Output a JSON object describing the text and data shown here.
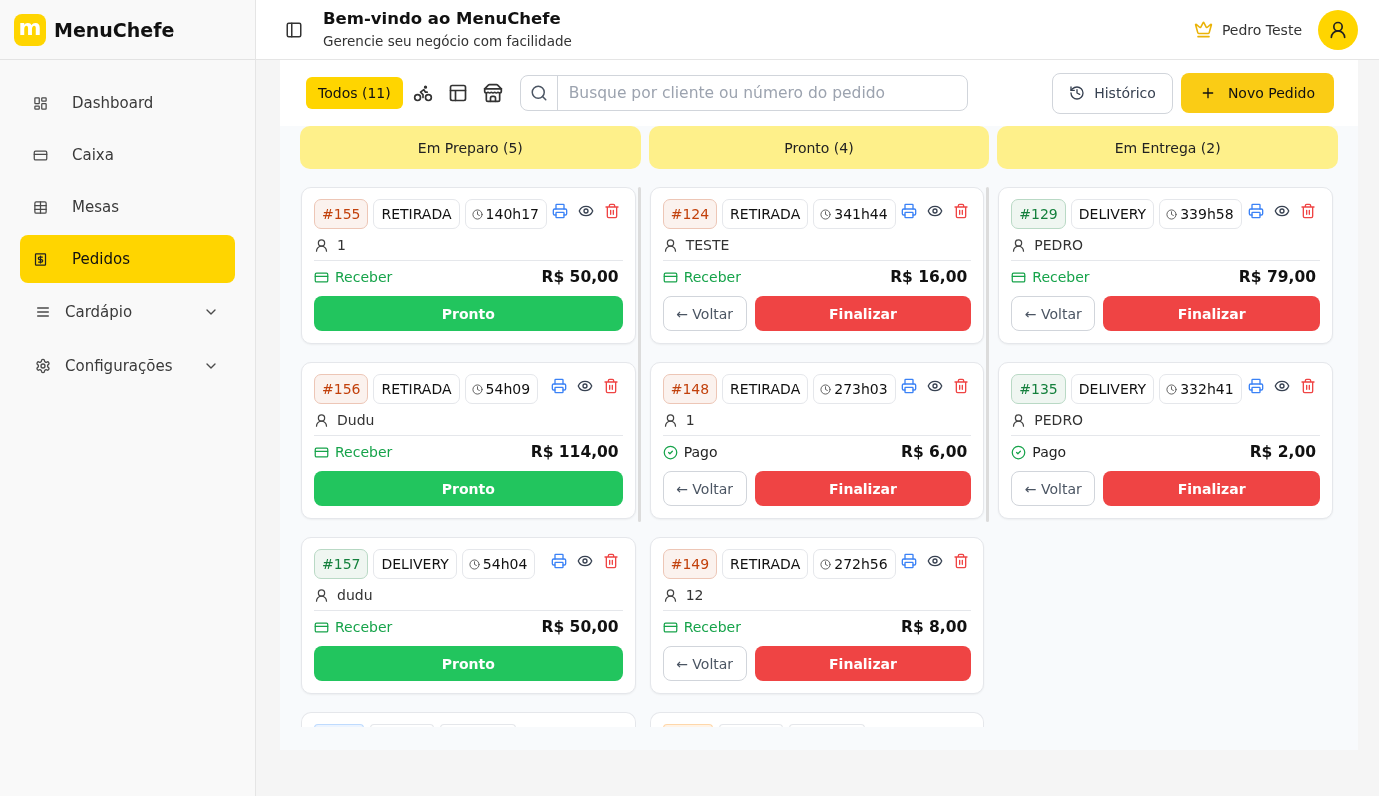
{
  "sidebar": {
    "logo": "m",
    "app_name": "MenuChefe",
    "items": [
      {
        "kind": "link",
        "label": "Dashboard",
        "selected": false
      },
      {
        "kind": "link",
        "label": "Caixa",
        "selected": false
      },
      {
        "kind": "link",
        "label": "Mesas",
        "selected": false
      },
      {
        "kind": "link",
        "label": "Pedidos",
        "selected": true
      },
      {
        "kind": "group",
        "label": "Cardápio",
        "selected": false,
        "expanded": false
      },
      {
        "kind": "group",
        "label": "Configurações",
        "selected": false,
        "expanded": false
      }
    ]
  },
  "header": {
    "title": "Bem-vindo ao MenuChefe",
    "subtitle": "Gerencie seu negócio com facilidade",
    "user": {
      "name": "Pedro Teste"
    }
  },
  "toolbar": {
    "filters": [
      {
        "kind": "text",
        "label": "Todos (11)",
        "selected": true
      },
      {
        "kind": "icon",
        "selected": false
      },
      {
        "kind": "icon",
        "selected": false
      },
      {
        "kind": "icon",
        "selected": false
      }
    ],
    "search": {
      "placeholder": "Busque por cliente ou número do pedido"
    },
    "buttons": [
      {
        "kind": "secondary",
        "label": "Histórico"
      },
      {
        "kind": "primary",
        "label": "Novo Pedido"
      }
    ]
  },
  "columns": [
    {
      "title": "Em Preparo (5)",
      "cards": [
        {
          "kind": "full",
          "order": "#155",
          "color": "#c2410c",
          "type": "RETIRADA",
          "time": "140h17",
          "customer": "1",
          "payment": {
            "kind": "pending",
            "label": "Receber"
          },
          "total": "R$ 50,00",
          "actions": [
            {
              "kind": "advance",
              "label": "Pronto"
            }
          ]
        },
        {
          "kind": "full",
          "order": "#156",
          "color": "#c2410c",
          "type": "RETIRADA",
          "time": "54h09",
          "customer": "Dudu",
          "payment": {
            "kind": "pending",
            "label": "Receber"
          },
          "total": "R$ 114,00",
          "actions": [
            {
              "kind": "advance",
              "label": "Pronto"
            }
          ]
        },
        {
          "kind": "full",
          "order": "#157",
          "color": "#15803d",
          "type": "DELIVERY",
          "time": "54h04",
          "customer": "dudu",
          "payment": {
            "kind": "pending",
            "label": "Receber"
          },
          "total": "R$ 50,00",
          "actions": [
            {
              "kind": "advance",
              "label": "Pronto"
            }
          ]
        },
        {
          "kind": "partial",
          "color": "#bfdbfe"
        }
      ]
    },
    {
      "title": "Pronto (4)",
      "cards": [
        {
          "kind": "full",
          "order": "#124",
          "color": "#c2410c",
          "type": "RETIRADA",
          "time": "341h44",
          "customer": "TESTE",
          "payment": {
            "kind": "pending",
            "label": "Receber"
          },
          "total": "R$ 16,00",
          "actions": [
            {
              "kind": "back",
              "label": "← Voltar"
            },
            {
              "kind": "finish",
              "label": "Finalizar"
            }
          ]
        },
        {
          "kind": "full",
          "order": "#148",
          "color": "#c2410c",
          "type": "RETIRADA",
          "time": "273h03",
          "customer": "1",
          "payment": {
            "kind": "paid",
            "label": "Pago"
          },
          "total": "R$ 6,00",
          "actions": [
            {
              "kind": "back",
              "label": "← Voltar"
            },
            {
              "kind": "finish",
              "label": "Finalizar"
            }
          ]
        },
        {
          "kind": "full",
          "order": "#149",
          "color": "#c2410c",
          "type": "RETIRADA",
          "time": "272h56",
          "customer": "12",
          "payment": {
            "kind": "pending",
            "label": "Receber"
          },
          "total": "R$ 8,00",
          "actions": [
            {
              "kind": "back",
              "label": "← Voltar"
            },
            {
              "kind": "finish",
              "label": "Finalizar"
            }
          ]
        },
        {
          "kind": "partial",
          "color": "#fed7aa"
        }
      ]
    },
    {
      "title": "Em Entrega (2)",
      "cards": [
        {
          "kind": "full",
          "order": "#129",
          "color": "#15803d",
          "type": "DELIVERY",
          "time": "339h58",
          "customer": "PEDRO",
          "payment": {
            "kind": "pending",
            "label": "Receber"
          },
          "total": "R$ 79,00",
          "actions": [
            {
              "kind": "back",
              "label": "← Voltar"
            },
            {
              "kind": "finish",
              "label": "Finalizar"
            }
          ]
        },
        {
          "kind": "full",
          "order": "#135",
          "color": "#15803d",
          "type": "DELIVERY",
          "time": "332h41",
          "customer": "PEDRO",
          "payment": {
            "kind": "paid",
            "label": "Pago"
          },
          "total": "R$ 2,00",
          "actions": [
            {
              "kind": "back",
              "label": "← Voltar"
            },
            {
              "kind": "finish",
              "label": "Finalizar"
            }
          ]
        }
      ]
    }
  ]
}
